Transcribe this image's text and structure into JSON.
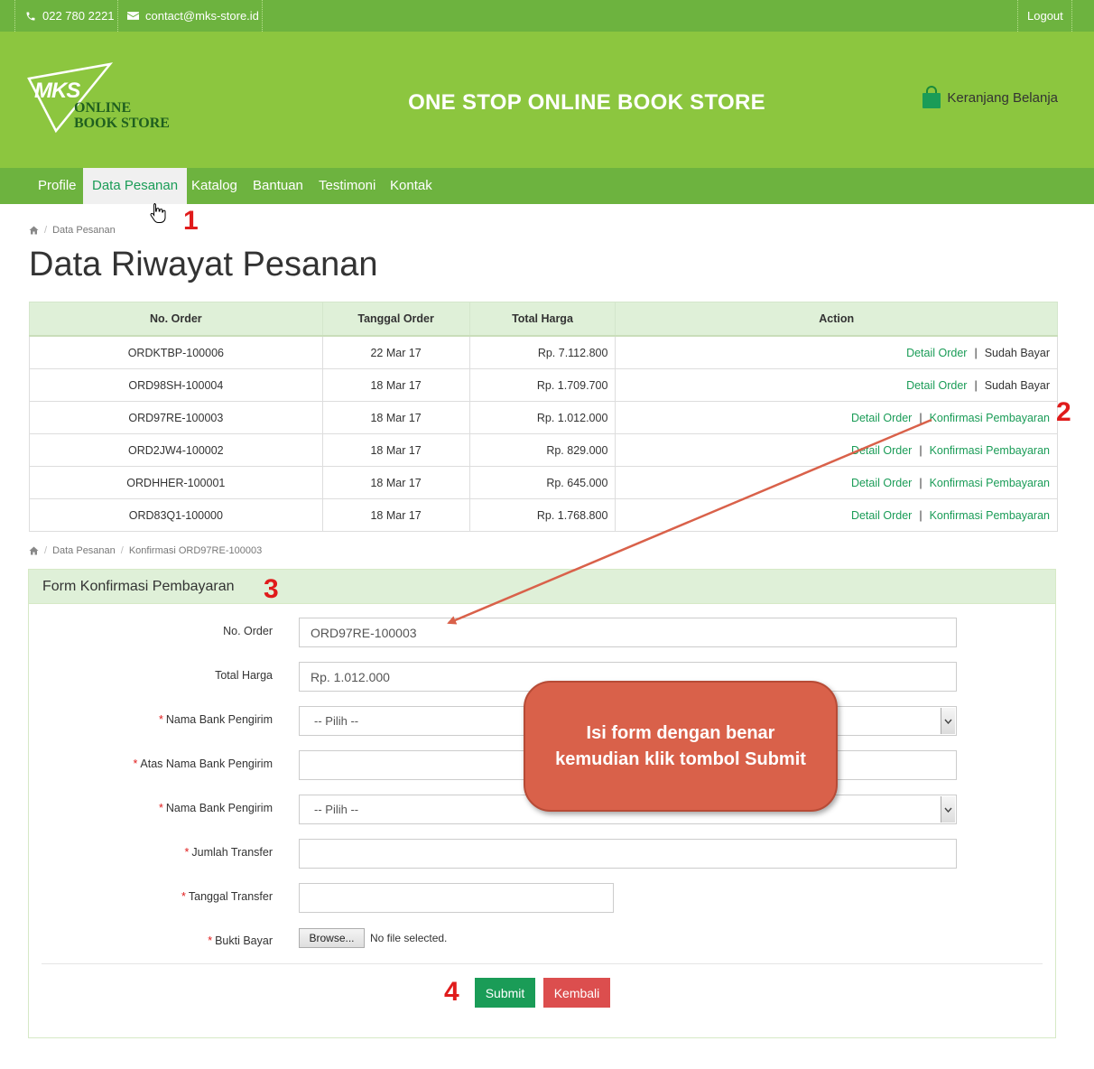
{
  "topbar": {
    "phone": "022 780 2221",
    "email": "contact@mks-store.id",
    "logout": "Logout"
  },
  "header": {
    "logo_mark": "MKS",
    "logo_line1": "ONLINE",
    "logo_line2": "BOOK STORE",
    "headline": "ONE STOP ONLINE BOOK STORE",
    "cart_label": "Keranjang Belanja"
  },
  "nav": {
    "items": [
      "Profile",
      "Data Pesanan",
      "Katalog",
      "Bantuan",
      "Testimoni",
      "Kontak"
    ],
    "active": "Data Pesanan"
  },
  "breadcrumb1": {
    "current": "Data Pesanan"
  },
  "page_title": "Data Riwayat Pesanan",
  "table": {
    "headers": [
      "No. Order",
      "Tanggal Order",
      "Total Harga",
      "Action"
    ],
    "rows": [
      {
        "order": "ORDKTBP-100006",
        "date": "22 Mar 17",
        "total": "Rp. 7.112.800",
        "detail": "Detail Order",
        "status": "Sudah Bayar",
        "status_link": false
      },
      {
        "order": "ORD98SH-100004",
        "date": "18 Mar 17",
        "total": "Rp. 1.709.700",
        "detail": "Detail Order",
        "status": "Sudah Bayar",
        "status_link": false
      },
      {
        "order": "ORD97RE-100003",
        "date": "18 Mar 17",
        "total": "Rp. 1.012.000",
        "detail": "Detail Order",
        "status": "Konfirmasi Pembayaran",
        "status_link": true
      },
      {
        "order": "ORD2JW4-100002",
        "date": "18 Mar 17",
        "total": "Rp. 829.000",
        "detail": "Detail Order",
        "status": "Konfirmasi Pembayaran",
        "status_link": true
      },
      {
        "order": "ORDHHER-100001",
        "date": "18 Mar 17",
        "total": "Rp. 645.000",
        "detail": "Detail Order",
        "status": "Konfirmasi Pembayaran",
        "status_link": true
      },
      {
        "order": "ORD83Q1-100000",
        "date": "18 Mar 17",
        "total": "Rp. 1.768.800",
        "detail": "Detail Order",
        "status": "Konfirmasi Pembayaran",
        "status_link": true
      }
    ],
    "separator": "|"
  },
  "breadcrumb2": {
    "parent": "Data Pesanan",
    "current": "Konfirmasi ORD97RE-100003"
  },
  "form": {
    "title": "Form Konfirmasi Pembayaran",
    "required_mark": "*",
    "labels": {
      "no_order": "No. Order",
      "total": "Total Harga",
      "bank1": "Nama Bank Pengirim",
      "atas_nama": "Atas Nama Bank Pengirim",
      "bank2": "Nama Bank Pengirim",
      "jumlah": "Jumlah Transfer",
      "tanggal": "Tanggal Transfer",
      "bukti": "Bukti Bayar"
    },
    "values": {
      "no_order": "ORD97RE-100003",
      "total": "Rp. 1.012.000",
      "bank1": "-- Pilih --",
      "atas_nama": "",
      "bank2": "-- Pilih --",
      "jumlah": "",
      "tanggal": ""
    },
    "browse_label": "Browse...",
    "no_file": "No file selected.",
    "submit": "Submit",
    "back": "Kembali"
  },
  "annotations": {
    "callout_line1": "Isi form dengan benar",
    "callout_line2": "kemudian klik tombol Submit",
    "markers": [
      "1",
      "2",
      "3",
      "4"
    ]
  },
  "colors": {
    "green_dark": "#6db33f",
    "green_header": "#8cc63f",
    "link": "#1a9c57",
    "marker": "#e01b1b",
    "callout": "#d9614a",
    "danger": "#dc4e4e"
  }
}
